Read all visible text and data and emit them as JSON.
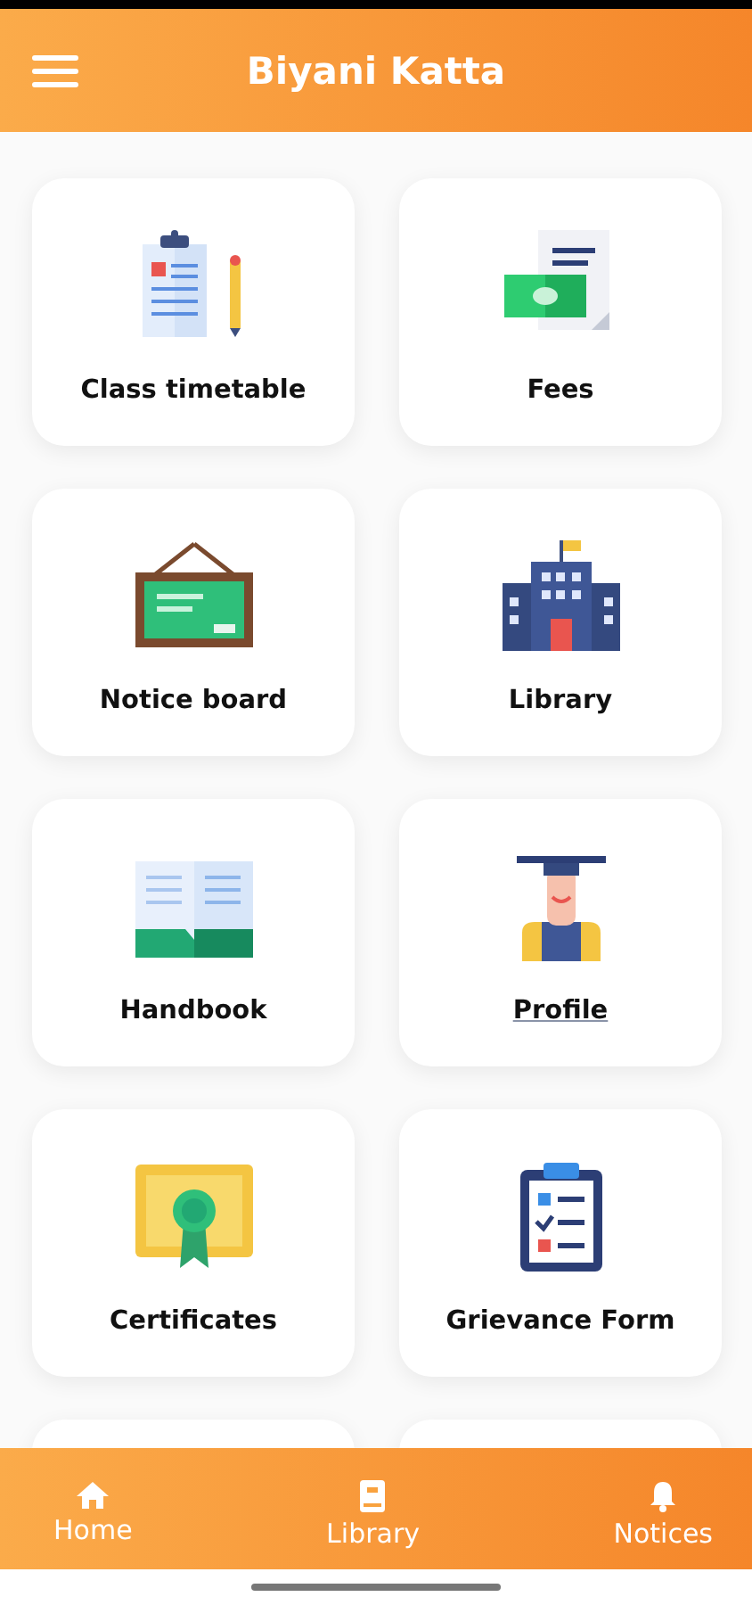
{
  "header": {
    "title": "Biyani Katta"
  },
  "tiles": [
    {
      "label": "Class timetable",
      "underlined": false
    },
    {
      "label": "Fees",
      "underlined": false
    },
    {
      "label": "Notice board",
      "underlined": false
    },
    {
      "label": "Library",
      "underlined": false
    },
    {
      "label": "Handbook",
      "underlined": false
    },
    {
      "label": "Profile",
      "underlined": true
    },
    {
      "label": "Certificates",
      "underlined": false
    },
    {
      "label": "Grievance Form",
      "underlined": false
    }
  ],
  "bottom_nav": [
    {
      "label": "Home"
    },
    {
      "label": "Library"
    },
    {
      "label": "Notices"
    }
  ]
}
